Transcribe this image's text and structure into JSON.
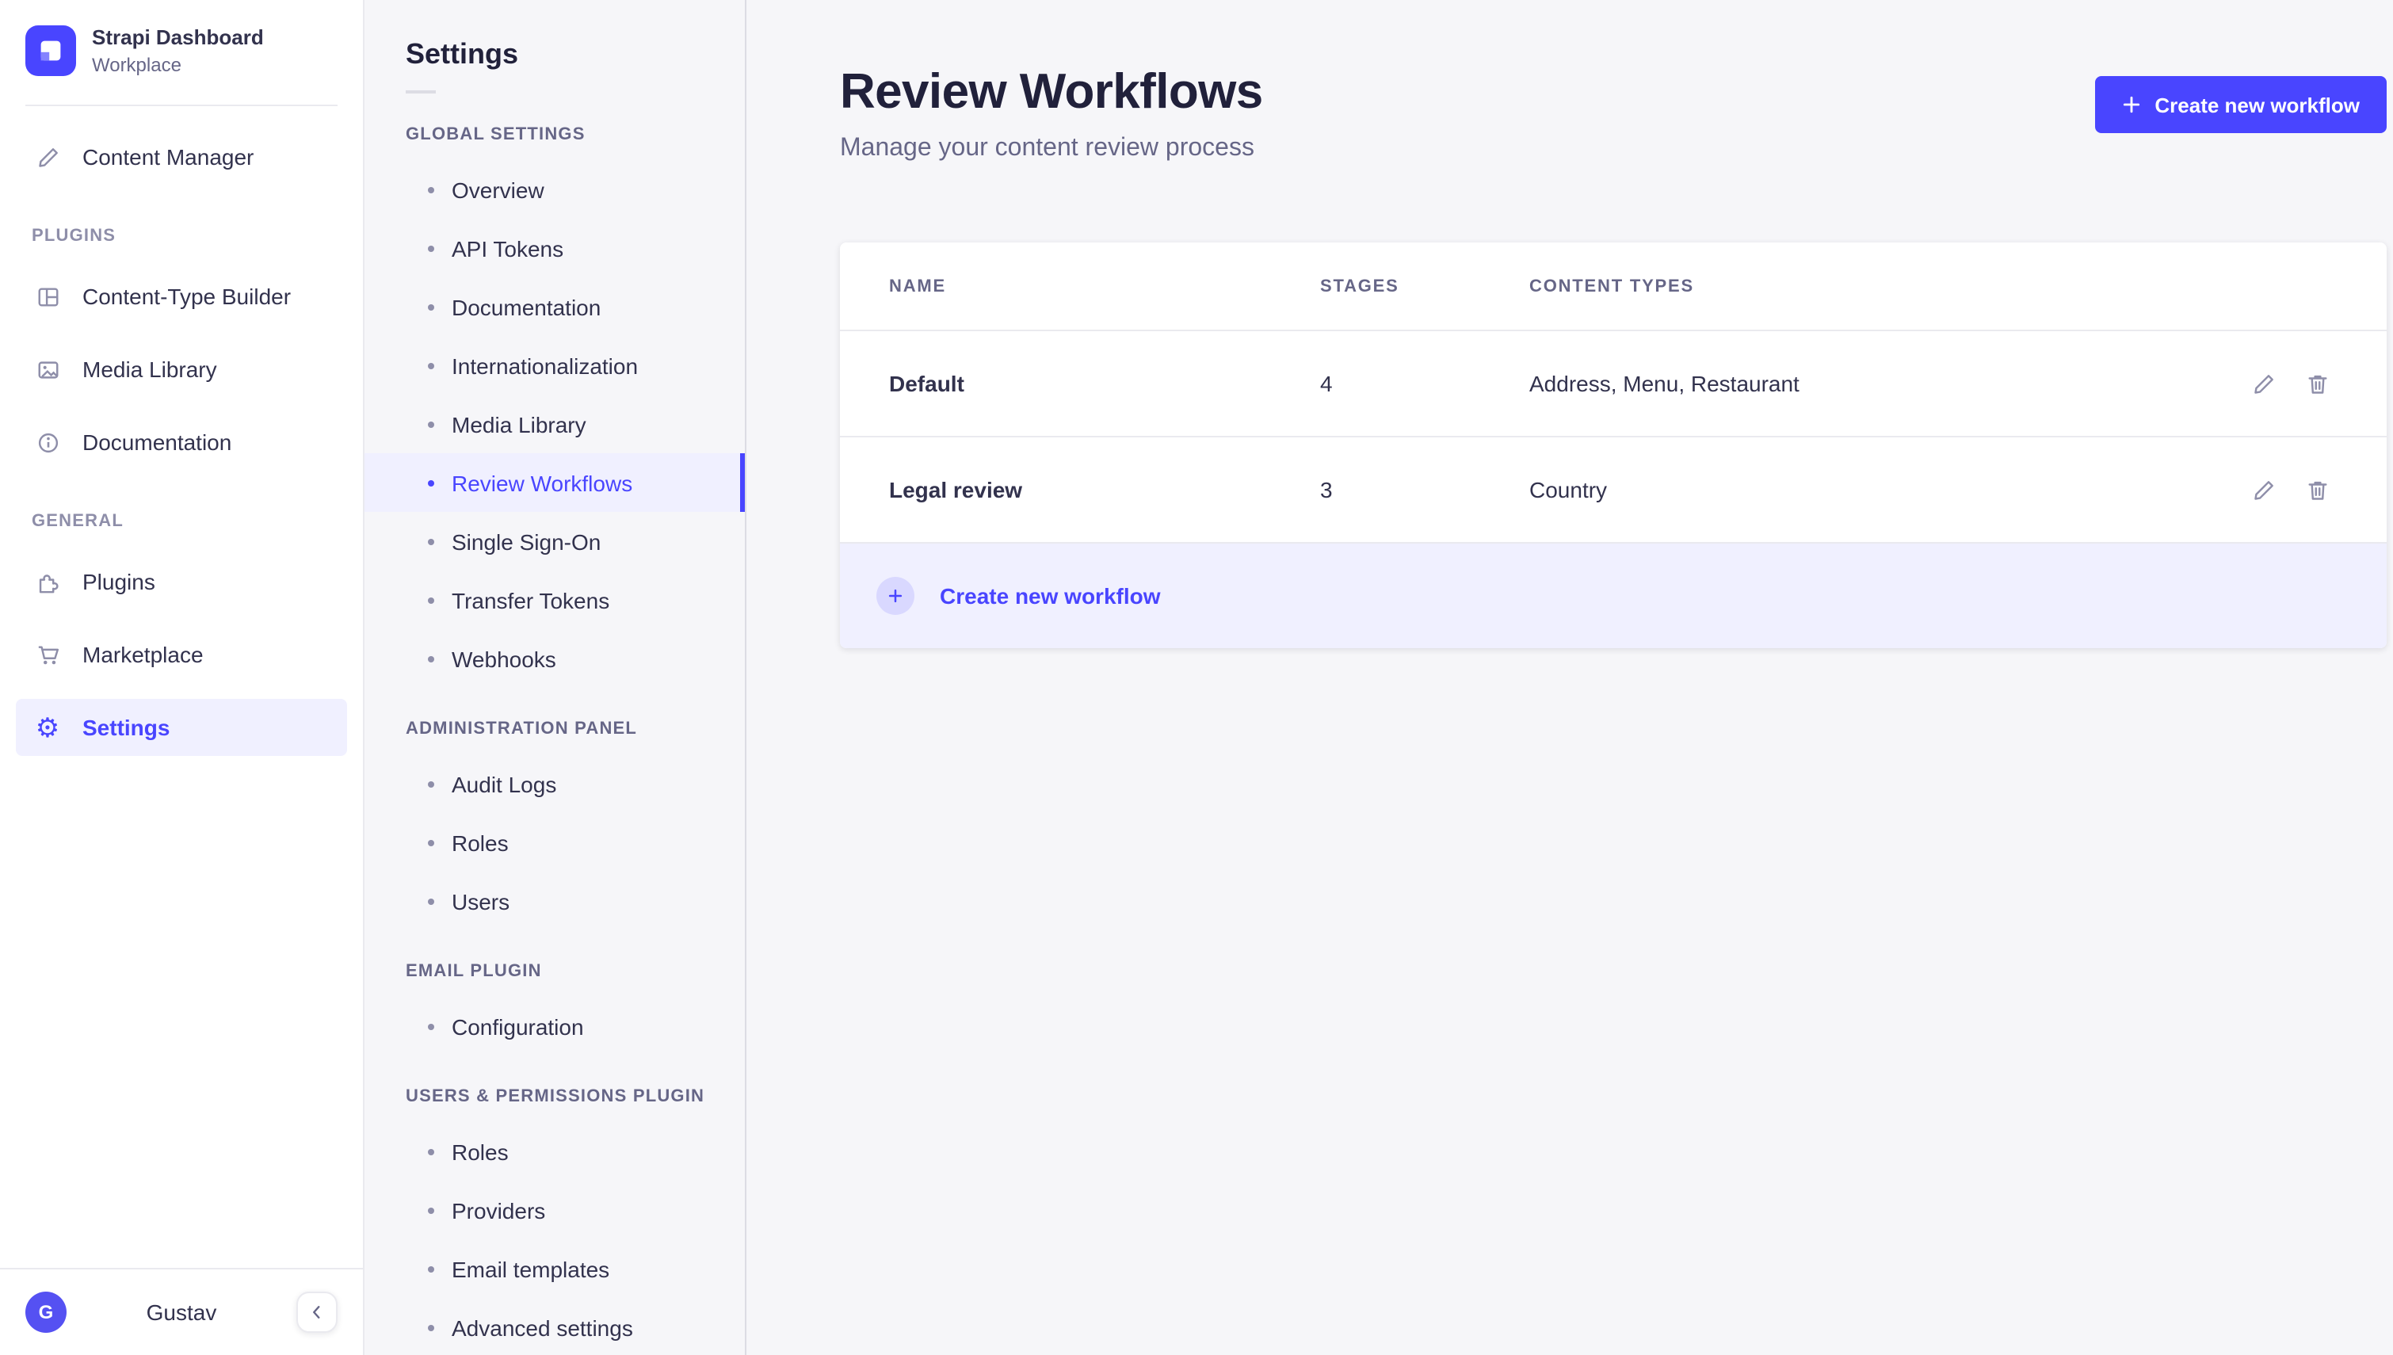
{
  "colors": {
    "primary": "#4945ff",
    "primary_light_bg": "#f0f0ff",
    "text_dark": "#32324d",
    "text_muted": "#666687",
    "icon_gray": "#8e8ea9"
  },
  "brand": {
    "name": "Strapi Dashboard",
    "workspace": "Workplace"
  },
  "sidebar": {
    "top_item": {
      "label": "Content Manager",
      "icon": "pencil-icon"
    },
    "sections": [
      {
        "label": "PLUGINS",
        "items": [
          {
            "label": "Content-Type Builder",
            "icon": "layout-icon"
          },
          {
            "label": "Media Library",
            "icon": "image-icon"
          },
          {
            "label": "Documentation",
            "icon": "info-icon"
          }
        ]
      },
      {
        "label": "GENERAL",
        "items": [
          {
            "label": "Plugins",
            "icon": "puzzle-icon"
          },
          {
            "label": "Marketplace",
            "icon": "cart-icon"
          },
          {
            "label": "Settings",
            "icon": "gear-icon",
            "active": true
          }
        ]
      }
    ],
    "gear_glyph": "⚙",
    "user": {
      "initial": "G",
      "name": "Gustav"
    }
  },
  "subnav": {
    "title": "Settings",
    "sections": [
      {
        "label": "GLOBAL SETTINGS",
        "items": [
          {
            "label": "Overview"
          },
          {
            "label": "API Tokens"
          },
          {
            "label": "Documentation"
          },
          {
            "label": "Internationalization"
          },
          {
            "label": "Media Library"
          },
          {
            "label": "Review Workflows",
            "active": true
          },
          {
            "label": "Single Sign-On"
          },
          {
            "label": "Transfer Tokens"
          },
          {
            "label": "Webhooks"
          }
        ]
      },
      {
        "label": "ADMINISTRATION PANEL",
        "items": [
          {
            "label": "Audit Logs"
          },
          {
            "label": "Roles"
          },
          {
            "label": "Users"
          }
        ]
      },
      {
        "label": "EMAIL PLUGIN",
        "items": [
          {
            "label": "Configuration"
          }
        ]
      },
      {
        "label": "USERS & PERMISSIONS PLUGIN",
        "items": [
          {
            "label": "Roles"
          },
          {
            "label": "Providers"
          },
          {
            "label": "Email templates"
          },
          {
            "label": "Advanced settings"
          }
        ]
      }
    ]
  },
  "main": {
    "title": "Review Workflows",
    "subtitle": "Manage your content review process",
    "create_button_label": "Create new workflow",
    "table": {
      "headers": {
        "name": "NAME",
        "stages": "STAGES",
        "content_types": "CONTENT TYPES"
      },
      "rows": [
        {
          "name": "Default",
          "stages": "4",
          "content_types": "Address, Menu, Restaurant"
        },
        {
          "name": "Legal review",
          "stages": "3",
          "content_types": "Country"
        }
      ],
      "footer_action_label": "Create new workflow"
    }
  }
}
